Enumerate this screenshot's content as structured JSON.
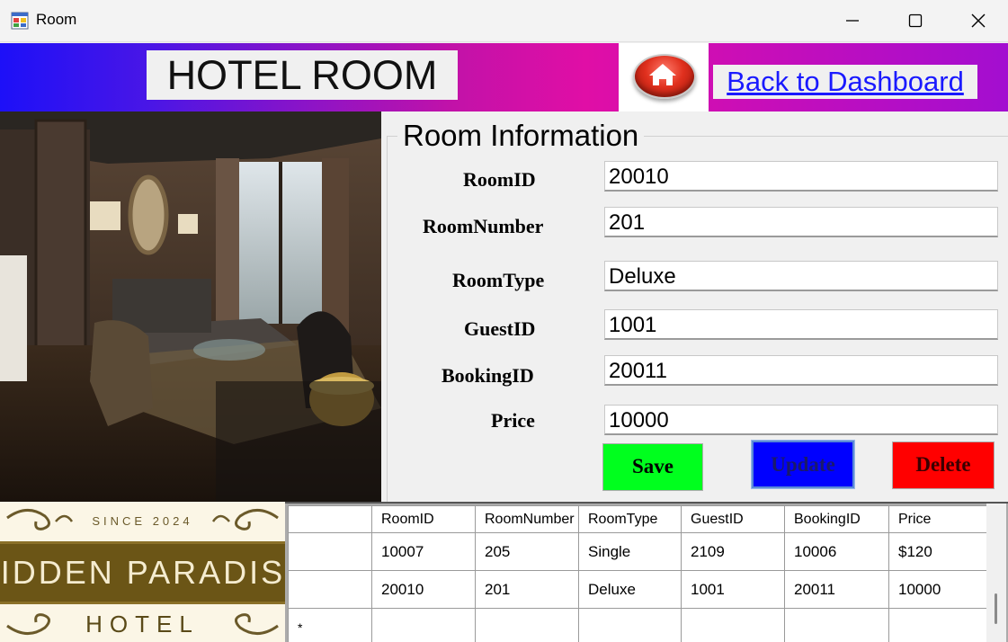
{
  "window": {
    "title": "Room"
  },
  "header": {
    "title": "HOTEL ROOM",
    "back_link": "Back to Dashboard"
  },
  "form": {
    "group_title": "Room Information",
    "fields": [
      {
        "label": "RoomID",
        "value": "20010"
      },
      {
        "label": "RoomNumber",
        "value": "201"
      },
      {
        "label": "RoomType",
        "value": "Deluxe"
      },
      {
        "label": "GuestID",
        "value": "1001"
      },
      {
        "label": "BookingID",
        "value": "20011"
      },
      {
        "label": "Price",
        "value": "10000"
      }
    ],
    "buttons": {
      "save": "Save",
      "update": "Update",
      "delete": "Delete"
    },
    "button_colors": {
      "save": "#00ff1e",
      "update": "#0000ff",
      "delete": "#ff0000"
    }
  },
  "logo": {
    "since": "SINCE 2024",
    "name": "IDDEN PARADIS",
    "subtitle": "HOTEL"
  },
  "grid": {
    "columns": [
      "RoomID",
      "RoomNumber",
      "RoomType",
      "GuestID",
      "BookingID",
      "Price"
    ],
    "rows": [
      [
        "10007",
        "205",
        "Single",
        "2109",
        "10006",
        "$120"
      ],
      [
        "20010",
        "201",
        "Deluxe",
        "1001",
        "20011",
        "10000"
      ]
    ],
    "new_row_marker": "*"
  },
  "colors": {
    "banner_start": "#1d10f8",
    "banner_mid": "#e00ea6",
    "banner_end": "#a30ed0",
    "link": "#1a1aff"
  }
}
